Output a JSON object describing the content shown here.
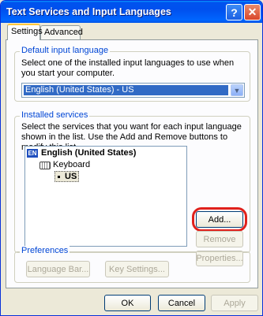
{
  "window": {
    "title": "Text Services and Input Languages",
    "help_glyph": "?",
    "close_glyph": "✕"
  },
  "tabs": [
    {
      "label": "Settings"
    },
    {
      "label": "Advanced"
    }
  ],
  "default_language": {
    "group_label": "Default input language",
    "description": "Select one of the installed input languages to use when you start your computer.",
    "selected": "English (United States) - US"
  },
  "installed_services": {
    "group_label": "Installed services",
    "description": "Select the services that you want for each input language shown in the list. Use the Add and Remove buttons to modify this list.",
    "language_badge": "EN",
    "language_name": "English (United States)",
    "keyboard_label": "Keyboard",
    "layout_label": "US",
    "add_label": "Add...",
    "remove_label": "Remove",
    "properties_label": "Properties..."
  },
  "preferences": {
    "group_label": "Preferences",
    "language_bar_label": "Language Bar...",
    "key_settings_label": "Key Settings..."
  },
  "footer": {
    "ok_label": "OK",
    "cancel_label": "Cancel",
    "apply_label": "Apply"
  },
  "colors": {
    "title_bar": "#0054e3",
    "group_label": "#0046d5",
    "highlight_ring": "#e0211c"
  }
}
